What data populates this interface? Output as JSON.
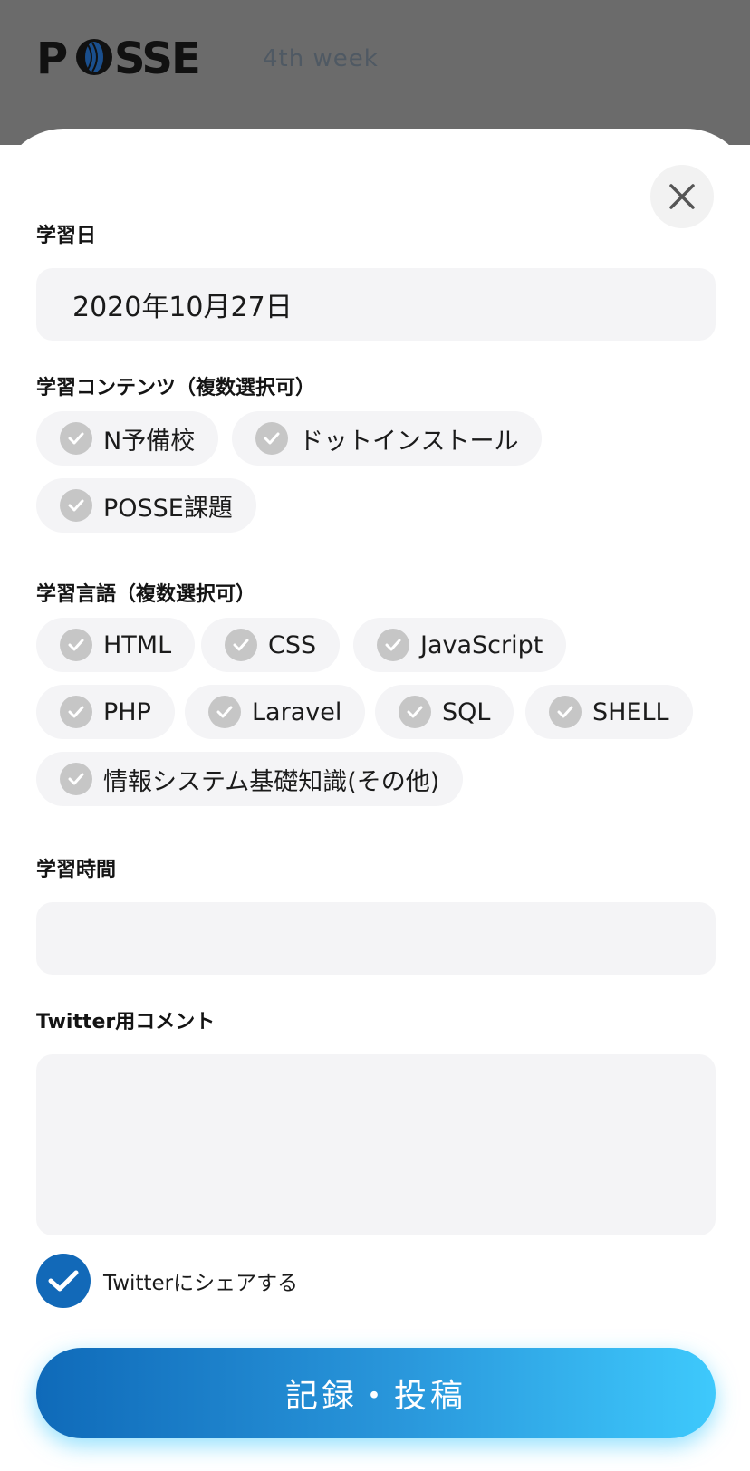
{
  "header": {
    "logo_text": "POSSE",
    "week_label": "4th week"
  },
  "form": {
    "date": {
      "label": "学習日",
      "value": "2020年10月27日"
    },
    "contents": {
      "label": "学習コンテンツ（複数選択可）",
      "options": [
        "N予備校",
        "ドットインストール",
        "POSSE課題"
      ]
    },
    "languages": {
      "label": "学習言語（複数選択可）",
      "options": [
        "HTML",
        "CSS",
        "JavaScript",
        "PHP",
        "Laravel",
        "SQL",
        "SHELL",
        "情報システム基礎知識(その他)"
      ]
    },
    "time": {
      "label": "学習時間",
      "value": ""
    },
    "comment": {
      "label": "Twitter用コメント",
      "value": ""
    },
    "share": {
      "label": "Twitterにシェアする",
      "checked": true
    },
    "submit_label": "記録・投稿"
  },
  "colors": {
    "brand_blue": "#1269b8",
    "gradient_end": "#3ec9fc",
    "chip_bg": "#f4f4f6",
    "chip_check": "#c6c6c6",
    "header_overlay": "#6b6b6b"
  },
  "icons": {
    "close": "close-icon",
    "chip_check": "check-icon",
    "share_check": "check-icon"
  }
}
